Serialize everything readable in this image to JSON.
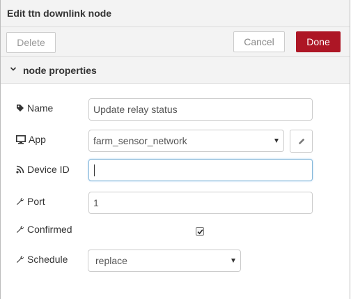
{
  "header": {
    "title": "Edit ttn downlink node"
  },
  "toolbar": {
    "delete_label": "Delete",
    "cancel_label": "Cancel",
    "done_label": "Done"
  },
  "section": {
    "title": "node properties",
    "expanded": true
  },
  "form": {
    "name": {
      "label": "Name",
      "value": "Update relay status",
      "icon": "tag-icon"
    },
    "app": {
      "label": "App",
      "value": "farm_sensor_network",
      "icon": "monitor-icon"
    },
    "device_id": {
      "label": "Device ID",
      "value": "",
      "icon": "rss-icon"
    },
    "port": {
      "label": "Port",
      "value": "1",
      "icon": "wrench-icon"
    },
    "confirmed": {
      "label": "Confirmed",
      "checked": true,
      "icon": "wrench-icon"
    },
    "schedule": {
      "label": "Schedule",
      "value": "replace",
      "icon": "wrench-icon"
    }
  },
  "colors": {
    "done_button": "#ad1625",
    "header_bg": "#f3f3f3",
    "focus_border": "#85b7d9"
  }
}
